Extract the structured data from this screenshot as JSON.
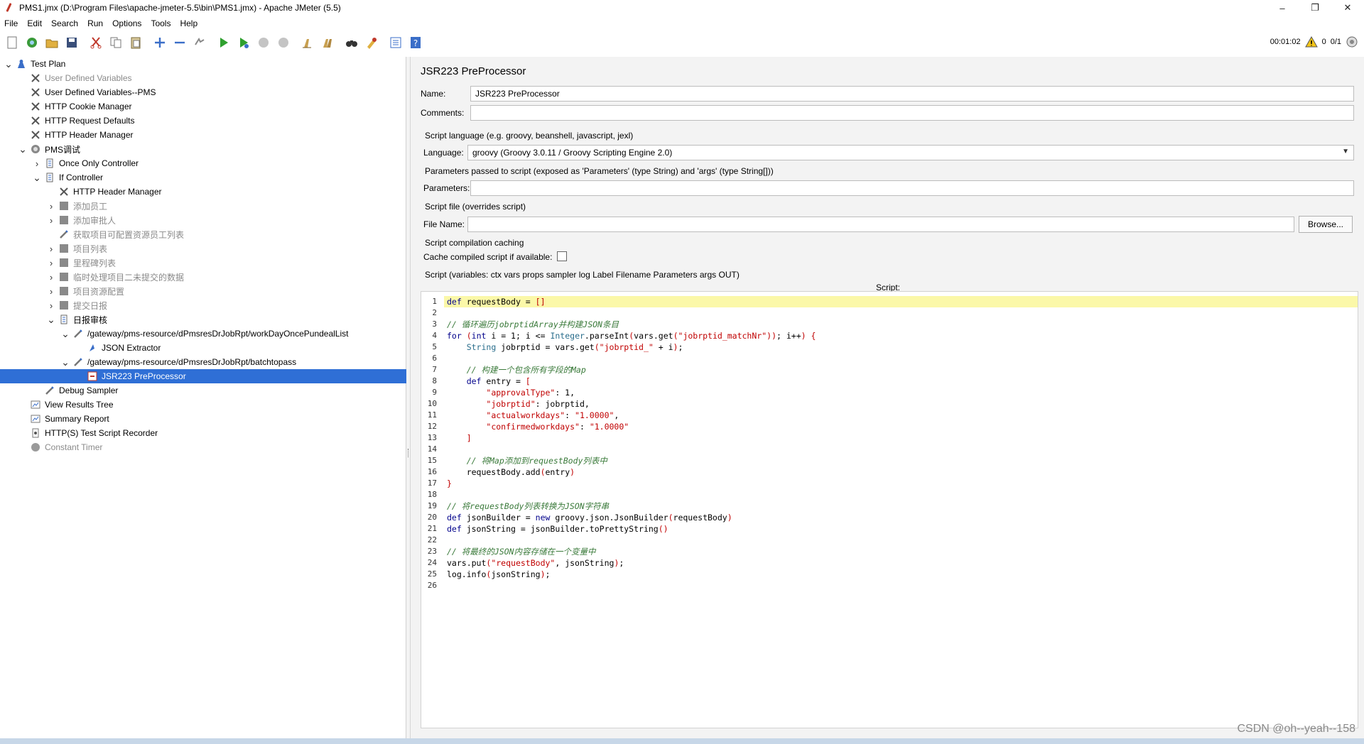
{
  "window": {
    "title": "PMS1.jmx (D:\\Program Files\\apache-jmeter-5.5\\bin\\PMS1.jmx) - Apache JMeter (5.5)",
    "minimize": "–",
    "maximize": "❐",
    "close": "✕"
  },
  "menu": [
    "File",
    "Edit",
    "Search",
    "Run",
    "Options",
    "Tools",
    "Help"
  ],
  "toolbar": {
    "elapsed": "00:01:02",
    "error_count": "0",
    "threads": "0/1"
  },
  "tree": [
    {
      "label": "Test Plan",
      "icon": "test-plan-icon"
    },
    {
      "label": "User Defined Variables",
      "icon": "wrench-icon"
    },
    {
      "label": "User Defined Variables--PMS",
      "icon": "wrench-icon"
    },
    {
      "label": "HTTP Cookie Manager",
      "icon": "wrench-icon"
    },
    {
      "label": "HTTP Request Defaults",
      "icon": "wrench-icon"
    },
    {
      "label": "HTTP Header Manager",
      "icon": "wrench-icon"
    },
    {
      "label": "PMS调试",
      "icon": "thread-group-icon"
    },
    {
      "label": "Once Only Controller",
      "icon": "controller-icon"
    },
    {
      "label": "If Controller",
      "icon": "controller-icon"
    },
    {
      "label": "HTTP Header Manager",
      "icon": "wrench-icon"
    },
    {
      "label": "添加员工",
      "icon": "disabled-controller-icon"
    },
    {
      "label": "添加审批人",
      "icon": "disabled-controller-icon"
    },
    {
      "label": "获取项目可配置资源员工列表",
      "icon": "sampler-icon"
    },
    {
      "label": "项目列表",
      "icon": "disabled-controller-icon"
    },
    {
      "label": "里程碑列表",
      "icon": "disabled-controller-icon"
    },
    {
      "label": "临时处理项目二未提交的数据",
      "icon": "disabled-controller-icon"
    },
    {
      "label": "项目资源配置",
      "icon": "disabled-controller-icon"
    },
    {
      "label": "提交日报",
      "icon": "disabled-controller-icon"
    },
    {
      "label": "日报审核",
      "icon": "controller-icon"
    },
    {
      "label": "/gateway/pms-resource/dPmsresDrJobRpt/workDayOncePundealList",
      "icon": "sampler-icon"
    },
    {
      "label": "JSON Extractor",
      "icon": "extractor-icon"
    },
    {
      "label": "/gateway/pms-resource/dPmsresDrJobRpt/batchtopass",
      "icon": "sampler-icon"
    },
    {
      "label": "JSR223 PreProcessor",
      "icon": "preprocessor-icon"
    },
    {
      "label": "Debug Sampler",
      "icon": "sampler-icon"
    },
    {
      "label": "View Results Tree",
      "icon": "listener-icon"
    },
    {
      "label": "Summary Report",
      "icon": "listener-icon"
    },
    {
      "label": "HTTP(S) Test Script Recorder",
      "icon": "recorder-icon"
    },
    {
      "label": "Constant Timer",
      "icon": "timer-icon"
    }
  ],
  "panel": {
    "title": "JSR223 PreProcessor",
    "name_label": "Name:",
    "name_value": "JSR223 PreProcessor",
    "comments_label": "Comments:",
    "comments_value": "",
    "lang_section": "Script language (e.g. groovy, beanshell, javascript, jexl)",
    "lang_label": "Language:",
    "lang_value": "groovy     (Groovy 3.0.11 / Groovy Scripting Engine 2.0)",
    "params_section": "Parameters passed to script (exposed as 'Parameters' (type String) and 'args' (type String[]))",
    "params_label": "Parameters:",
    "params_value": "",
    "file_section": "Script file (overrides script)",
    "file_label": "File Name:",
    "file_value": "",
    "browse": "Browse...",
    "cache_section": "Script compilation caching",
    "cache_label": "Cache compiled script if available:",
    "cache_checked": false,
    "script_section": "Script (variables: ctx vars props sampler log Label Filename Parameters args OUT)",
    "script_label": "Script:"
  },
  "code": [
    "def requestBody = []",
    "",
    "// 循环遍历jobrptidArray并构建JSON条目",
    "for (int i = 1; i <= Integer.parseInt(vars.get(\"jobrptid_matchNr\")); i++) {",
    "    String jobrptid = vars.get(\"jobrptid_\" + i);",
    "",
    "    // 构建一个包含所有字段的Map",
    "    def entry = [",
    "        \"approvalType\": 1,",
    "        \"jobrptid\": jobrptid,",
    "        \"actualworkdays\": \"1.0000\",",
    "        \"confirmedworkdays\": \"1.0000\"",
    "    ]",
    "",
    "    // 将Map添加到requestBody列表中",
    "    requestBody.add(entry)",
    "}",
    "",
    "// 将requestBody列表转换为JSON字符串",
    "def jsonBuilder = new groovy.json.JsonBuilder(requestBody)",
    "def jsonString = jsonBuilder.toPrettyString()",
    "",
    "// 将最终的JSON内容存储在一个变量中",
    "vars.put(\"requestBody\", jsonString);",
    "log.info(jsonString);",
    ""
  ],
  "line_numbers": [
    "1",
    "2",
    "3",
    "4",
    "5",
    "6",
    "7",
    "8",
    "9",
    "10",
    "11",
    "12",
    "13",
    "14",
    "15",
    "16",
    "17",
    "18",
    "19",
    "20",
    "21",
    "22",
    "23",
    "24",
    "25",
    "26"
  ],
  "watermark": "CSDN @oh--yeah--158",
  "colors": {
    "selection": "#2f6fd6",
    "current_line": "#fbf8a8",
    "keyword": "#00008b",
    "comment": "#3a7a3a",
    "string": "#c00000"
  }
}
